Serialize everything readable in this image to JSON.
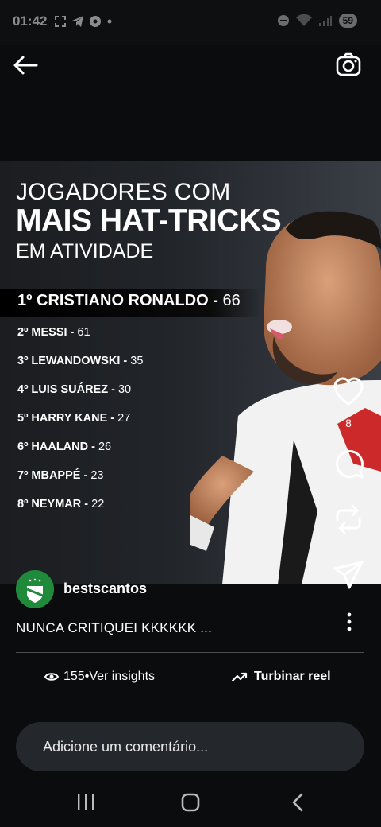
{
  "status": {
    "time": "01:42",
    "battery": "59"
  },
  "post": {
    "title_line1": "JOGADORES COM",
    "title_line2": "MAIS HAT-TRICKS",
    "title_line3": "EM ATIVIDADE",
    "first": {
      "rank": "1º",
      "name": "CRISTIANO RONALDO",
      "sep": " - ",
      "value": "66"
    },
    "ranking": [
      {
        "rank": "2º",
        "name": "MESSI",
        "sep": " - ",
        "value": "61"
      },
      {
        "rank": "3º",
        "name": "LEWANDOWSKI",
        "sep": " - ",
        "value": "35"
      },
      {
        "rank": "4º",
        "name": "LUIS SUÁREZ",
        "sep": " - ",
        "value": "30"
      },
      {
        "rank": "5º",
        "name": "HARRY KANE",
        "sep": " - ",
        "value": "27"
      },
      {
        "rank": "6º",
        "name": "HAALAND",
        "sep": " - ",
        "value": "26"
      },
      {
        "rank": "7º",
        "name": "MBAPPÉ",
        "sep": " - ",
        "value": "23"
      },
      {
        "rank": "8º",
        "name": "NEYMAR",
        "sep": " - ",
        "value": "22"
      }
    ]
  },
  "actions": {
    "like_count": "8"
  },
  "author": {
    "username": "bestscantos"
  },
  "caption": "NUNCA CRITIQUEI KKKKKK ...",
  "insights": {
    "views": "155",
    "separator": " • ",
    "label": "Ver insights"
  },
  "boost": {
    "label": "Turbinar reel"
  },
  "comment": {
    "placeholder": "Adicione um comentário..."
  },
  "icons": {
    "back": "arrow-left-icon",
    "camera": "camera-icon",
    "like": "heart-icon",
    "comment": "comment-icon",
    "repost": "repost-icon",
    "share": "send-icon",
    "more": "more-vertical-icon",
    "eye": "eye-icon",
    "trend": "trending-up-icon"
  },
  "colors": {
    "background": "#0a0c0d",
    "comment_bg": "#24272b",
    "avatar_bg": "#1f8a3a"
  }
}
